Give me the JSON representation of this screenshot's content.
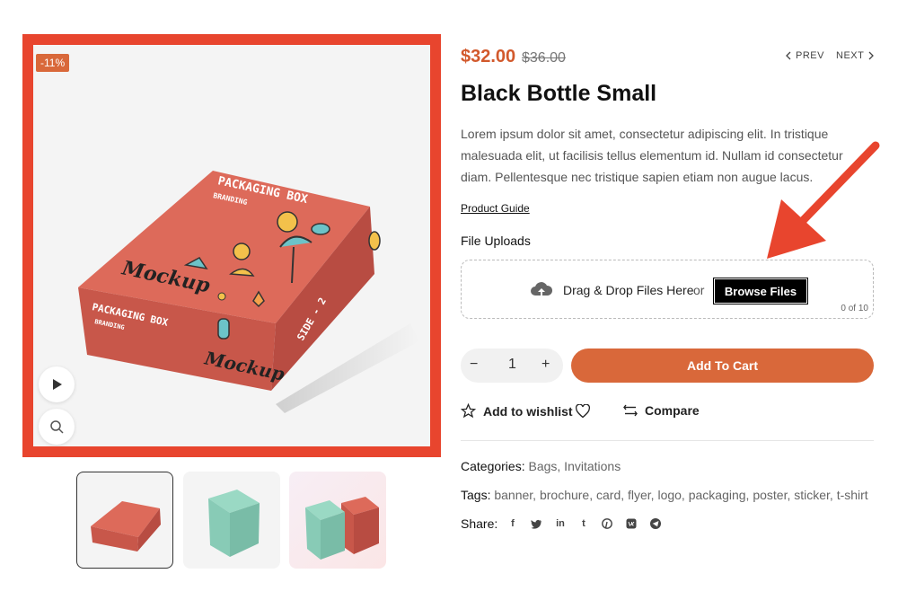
{
  "gallery": {
    "badge": "-11%",
    "box_front_text": "PACKAGING BOX",
    "box_front_sub": "BRANDING",
    "box_top_text": "PACKAGING BOX",
    "box_top_sub": "BRANDING",
    "box_mockup": "Mockup",
    "box_side_text": "SIDE - 2",
    "thumbnails": [
      "thumb-red-box",
      "thumb-mint-box",
      "thumb-mint-red-boxes"
    ]
  },
  "product": {
    "price_current": "$32.00",
    "price_old": "$36.00",
    "prev_label": "PREV",
    "next_label": "NEXT",
    "title": "Black Bottle Small",
    "description": "Lorem ipsum dolor sit amet, consectetur adipiscing elit. In tristique malesuada elit, ut facilisis tellus elementum id. Nullam id consectetur diam. Pellentesque nec tristique sapien etiam non augue lacus.",
    "guide_label": "Product Guide"
  },
  "uploads": {
    "label": "File Uploads",
    "drag_text": "Drag & Drop Files Here",
    "or_text": "or",
    "browse_label": "Browse Files",
    "count": "0 of 10"
  },
  "cart": {
    "minus": "−",
    "quantity": "1",
    "plus": "+",
    "add_label": "Add To Cart"
  },
  "actions": {
    "wishlist_label": "Add to wishlist",
    "compare_label": "Compare"
  },
  "meta": {
    "categories_label": "Categories:",
    "categories_value": "Bags, Invitations",
    "tags_label": "Tags:",
    "tags_value": "banner, brochure, card, flyer, logo, packaging, poster, sticker, t-shirt",
    "share_label": "Share:"
  },
  "colors": {
    "accent": "#d9683a",
    "price": "#d2592c",
    "annotation": "#e8452e"
  }
}
